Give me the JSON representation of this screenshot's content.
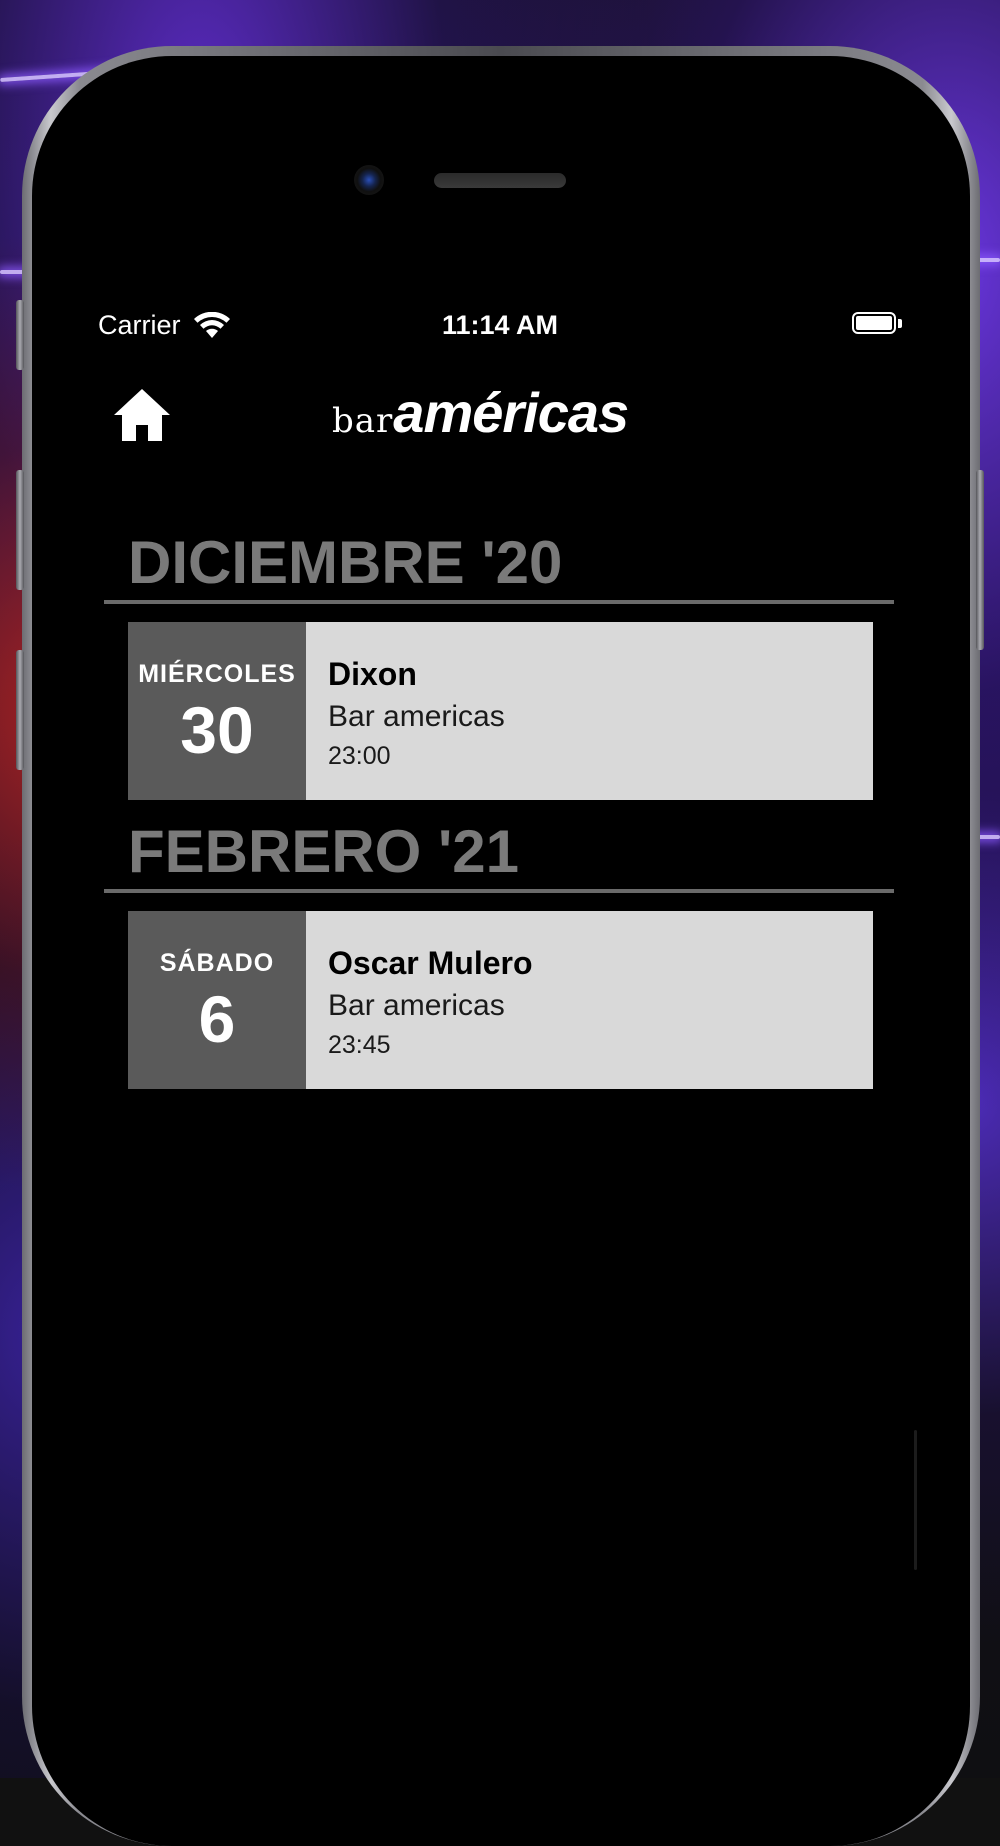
{
  "status_bar": {
    "carrier": "Carrier",
    "time": "11:14 AM",
    "wifi_icon": "wifi-icon",
    "battery_icon": "battery-icon"
  },
  "nav": {
    "home_icon": "home-icon",
    "logo_small": "bar",
    "logo_large": "américas"
  },
  "colors": {
    "background": "#000000",
    "month_header": "#7a7a7a",
    "divider": "#6a6a6a",
    "date_block": "#5a5a5a",
    "card": "#d9d9d9"
  },
  "sections": [
    {
      "month": "DICIEMBRE '20",
      "events": [
        {
          "weekday": "MIÉRCOLES",
          "day": "30",
          "artist": "Dixon",
          "venue": "Bar americas",
          "time": "23:00"
        }
      ]
    },
    {
      "month": "FEBRERO '21",
      "events": [
        {
          "weekday": "SÁBADO",
          "day": "6",
          "artist": "Oscar Mulero",
          "venue": "Bar americas",
          "time": "23:45"
        }
      ]
    }
  ]
}
